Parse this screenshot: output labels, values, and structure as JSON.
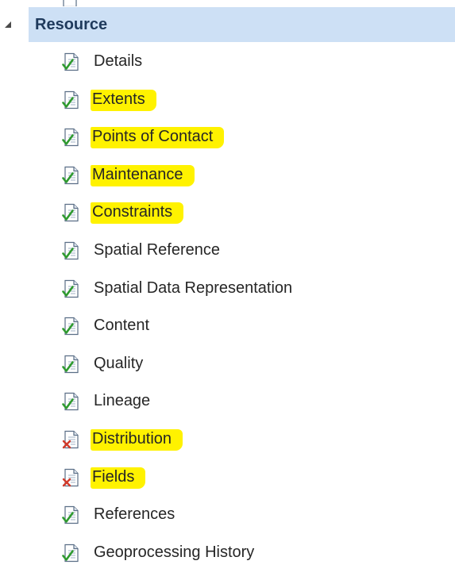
{
  "colors": {
    "header_bg": "#cde0f5",
    "highlight": "#fff200",
    "check_green": "#2e9a2e",
    "error_red": "#d23a2a"
  },
  "group": {
    "label": "Resource",
    "expanded": true,
    "expander_icon": "collapse-triangle-icon"
  },
  "items": [
    {
      "label": "Details",
      "status": "valid",
      "highlighted": false
    },
    {
      "label": "Extents",
      "status": "valid",
      "highlighted": true
    },
    {
      "label": "Points of Contact",
      "status": "valid",
      "highlighted": true
    },
    {
      "label": "Maintenance",
      "status": "valid",
      "highlighted": true
    },
    {
      "label": "Constraints",
      "status": "valid",
      "highlighted": true
    },
    {
      "label": "Spatial Reference",
      "status": "valid",
      "highlighted": false
    },
    {
      "label": "Spatial Data Representation",
      "status": "valid",
      "highlighted": false
    },
    {
      "label": "Content",
      "status": "valid",
      "highlighted": false
    },
    {
      "label": "Quality",
      "status": "valid",
      "highlighted": false
    },
    {
      "label": "Lineage",
      "status": "valid",
      "highlighted": false
    },
    {
      "label": "Distribution",
      "status": "error",
      "highlighted": true
    },
    {
      "label": "Fields",
      "status": "error",
      "highlighted": true
    },
    {
      "label": "References",
      "status": "valid",
      "highlighted": false
    },
    {
      "label": "Geoprocessing History",
      "status": "valid",
      "highlighted": false
    }
  ]
}
